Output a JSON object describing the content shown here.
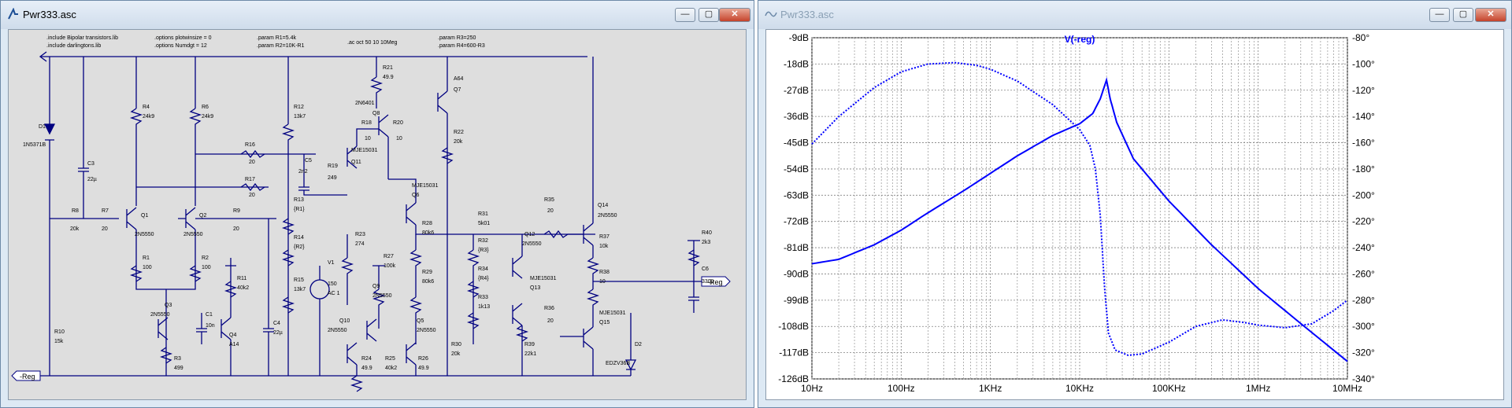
{
  "windows": {
    "schematic": {
      "title": "Pwr333.asc"
    },
    "plot": {
      "title": "Pwr333.asc"
    }
  },
  "window_buttons": {
    "minimize": "—",
    "maximize": "▢",
    "close": "✕"
  },
  "directives": {
    "include1": ".include Bipolar transistors.lib",
    "include2": ".include darlingtons.lib",
    "opt1": ".options plotwinsize = 0",
    "opt2": ".options Numdgt = 12",
    "param1": ".param R1=5.4k",
    "param2": ".param R2=10K-R1",
    "ac": ".ac oct 50 10 10Meg",
    "param3": ".param R3=250",
    "param4": ".param R4=600-R3"
  },
  "components": {
    "D1": "D1",
    "D1v": "1N5371B",
    "C3": "C3",
    "C3v": "22µ",
    "R4": "R4",
    "R4v": "24k9",
    "R6": "R6",
    "R6v": "24k9",
    "R12": "R12",
    "R12v": "13k7",
    "R21": "R21",
    "R21v": "49.9",
    "Q7n": "2N6401",
    "Q8": "Q8",
    "A64": "A64",
    "Q7": "Q7",
    "R18a": "R18",
    "R18av": "10",
    "R20": "R20",
    "R20v": "10",
    "R22": "R22",
    "R22v": "20k",
    "R16": "R16",
    "R16v": "20",
    "MJE1": "MJE15031",
    "Q11": "Q11",
    "C5": "C5",
    "C5v": "2n2",
    "R19": "R19",
    "R19v": "249",
    "R17": "R17",
    "R17v": "20",
    "MJE2": "MJE15031",
    "Q6": "Q6",
    "R8": "R8",
    "R8v": "20k",
    "R7": "R7",
    "R7v": "20",
    "Q1": "Q1",
    "Q1n": "2N5550",
    "Q2": "Q2",
    "Q2n": "2N5550",
    "R9": "R9",
    "R9v": "20",
    "R13": "R13",
    "R13v": "{R1}",
    "R14": "R14",
    "R14v": "{R2}",
    "R35": "R35",
    "R35v": "20",
    "Q14": "Q14",
    "Q14n": "2N5550",
    "R31": "R31",
    "R31v": "5k01",
    "R32": "R32",
    "R32v": "{R3}",
    "R34": "R34",
    "R34v": "{R4}",
    "R33": "R33",
    "R33v": "1k13",
    "Q12": "Q12",
    "Q12n": "2N5550",
    "MJE3": "MJE15031",
    "Q13": "Q13",
    "R37": "R37",
    "R37v": "10k",
    "R38": "R38",
    "R38v": "10",
    "R40": "R40",
    "R40v": "2k3",
    "C6": "C6",
    "C6v": "330µ",
    "R23": "R23",
    "R23v": "274",
    "R28": "R28",
    "R28v": "80k6",
    "R27": "R27",
    "R27v": "100k",
    "V1": "V1",
    "V1v": "150",
    "V1ac": "AC 1",
    "R29": "R29",
    "R29v": "80k6",
    "R1": "R1",
    "R1v": "100",
    "R2": "R2",
    "R2v": "100",
    "R11": "R11",
    "R11v": "40k2",
    "Q3": "Q3",
    "Q3n": "2N5550",
    "C1": "C1",
    "C1v": "10n",
    "Q4": "Q4",
    "Q4n": "A14",
    "C4": "C4",
    "C4v": "22µ",
    "R15": "R15",
    "R15v": "13k7",
    "Q9": "Q9",
    "Q9n": "2N5550",
    "Q10": "Q10",
    "Q10n": "2N5550",
    "Q5": "Q5",
    "Q5n": "2N5550",
    "R36": "R36",
    "R36v": "20",
    "MJE4": "MJE15031",
    "Q15": "Q15",
    "R10": "R10",
    "R10v": "15k",
    "R3": "R3",
    "R3v": "499",
    "R24": "R24",
    "R24v": "49.9",
    "R25": "R25",
    "R25v": "40k2",
    "R26": "R26",
    "R26v": "49.9",
    "R30": "R30",
    "R30v": "20k",
    "R39": "R39",
    "R39v": "22k1",
    "D2": "D2",
    "D2v": "EDZV36B"
  },
  "ports": {
    "reg_out": "-Reg",
    "reg_in": "-Reg"
  },
  "chart_data": {
    "type": "line",
    "title": "V(-reg)",
    "x_scale": "log",
    "x_range": [
      10,
      10000000
    ],
    "x_ticks": [
      "10Hz",
      "100Hz",
      "1KHz",
      "10KHz",
      "100KHz",
      "1MHz",
      "10MHz"
    ],
    "y_left_range": [
      -126,
      -9
    ],
    "y_left_ticks": [
      "-9dB",
      "-18dB",
      "-27dB",
      "-36dB",
      "-45dB",
      "-54dB",
      "-63dB",
      "-72dB",
      "-81dB",
      "-90dB",
      "-99dB",
      "-108dB",
      "-117dB",
      "-126dB"
    ],
    "y_right_range": [
      -340,
      -80
    ],
    "y_right_ticks": [
      "-80°",
      "-100°",
      "-120°",
      "-140°",
      "-160°",
      "-180°",
      "-200°",
      "-220°",
      "-240°",
      "-260°",
      "-280°",
      "-300°",
      "-320°",
      "-340°"
    ],
    "grid": true,
    "line_color": "#0000ff",
    "series": [
      {
        "style": "solid",
        "axis": "left",
        "x": [
          10,
          20,
          50,
          100,
          200,
          500,
          1000,
          2000,
          5000,
          10000,
          14000,
          17000,
          20000,
          22000,
          26000,
          40000,
          100000,
          300000,
          1000000,
          3000000,
          10000000
        ],
        "y": [
          -86.5,
          -85,
          -80,
          -75,
          -69,
          -61.5,
          -55.5,
          -49.5,
          -42.5,
          -38.5,
          -35,
          -30,
          -23.5,
          -30,
          -38,
          -50.5,
          -65,
          -80,
          -95,
          -107,
          -120
        ]
      },
      {
        "style": "dotted",
        "axis": "right",
        "x": [
          10,
          20,
          50,
          100,
          200,
          400,
          700,
          1000,
          2000,
          5000,
          10000,
          13000,
          15000,
          17000,
          19000,
          21000,
          25000,
          35000,
          50000,
          100000,
          200000,
          400000,
          700000,
          1000000,
          2000000,
          4000000,
          7000000,
          10000000
        ],
        "y": [
          -161,
          -140,
          -118,
          -106,
          -100,
          -99,
          -101,
          -104,
          -113,
          -131,
          -150,
          -162,
          -180,
          -215,
          -270,
          -305,
          -318,
          -322,
          -321,
          -312,
          -300,
          -295,
          -297,
          -299,
          -301,
          -298,
          -288,
          -280
        ]
      }
    ]
  }
}
